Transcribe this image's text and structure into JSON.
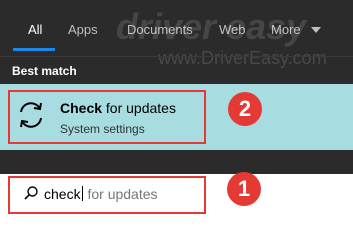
{
  "tabs": [
    {
      "label": "All",
      "active": true
    },
    {
      "label": "Apps"
    },
    {
      "label": "Documents"
    },
    {
      "label": "Web"
    },
    {
      "label": "More"
    }
  ],
  "section_label": "Best match",
  "result": {
    "title_bold": "Check",
    "title_rest": " for updates",
    "subtitle": "System settings",
    "icon": "sync-icon"
  },
  "search": {
    "typed": "check",
    "suggestion": " for updates",
    "icon": "search-icon"
  },
  "callouts": {
    "one": "1",
    "two": "2"
  },
  "watermark": {
    "brand": "driver easy",
    "url": "www.DriverEasy.com"
  },
  "colors": {
    "panel_bg": "#2b2b2b",
    "highlight_bg": "#a7dce0",
    "accent": "#1e88e5",
    "callout": "#e53935"
  }
}
